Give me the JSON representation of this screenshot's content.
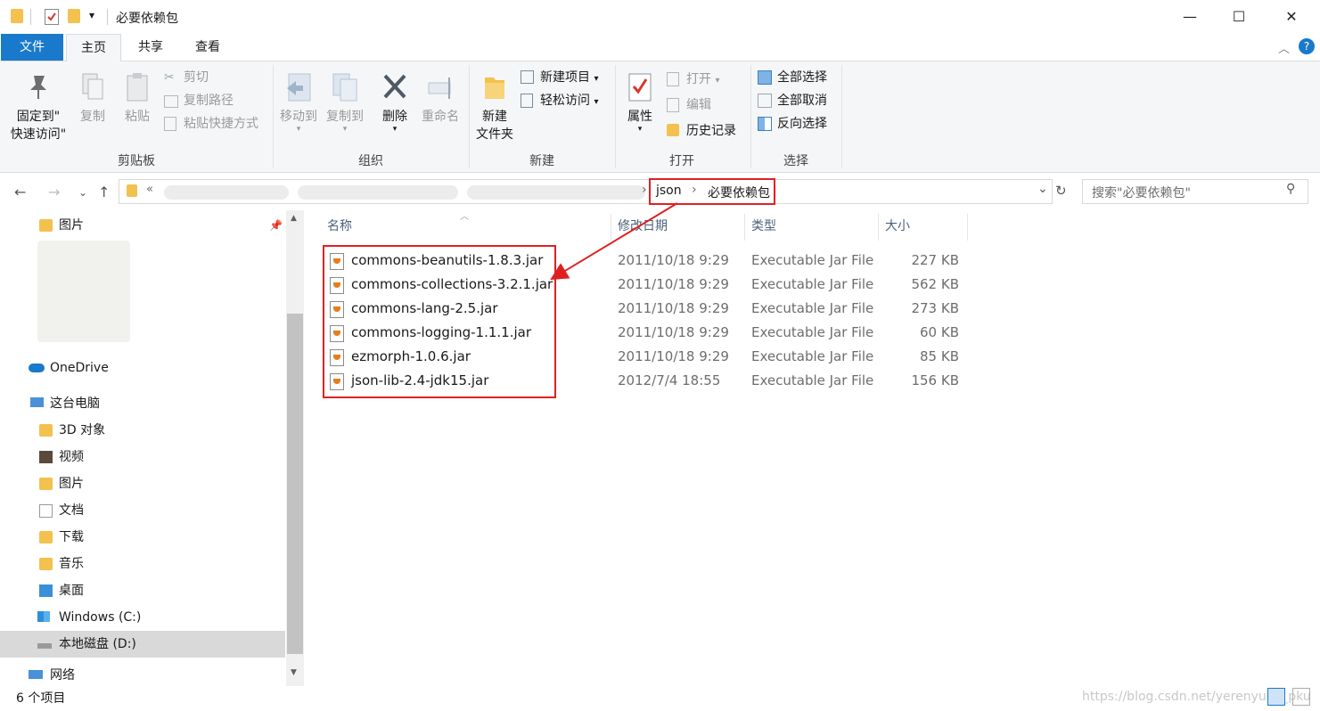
{
  "window": {
    "title": "必要依赖包",
    "controls": {
      "minimize": "—",
      "maximize": "☐",
      "close": "✕"
    },
    "qa_dropdown": "▾"
  },
  "ribbon_tabs": {
    "file": "文件",
    "home": "主页",
    "share": "共享",
    "view": "查看"
  },
  "ribbon": {
    "clipboard": {
      "pin_line1": "固定到\"",
      "pin_line2": "快速访问\"",
      "copy": "复制",
      "paste": "粘贴",
      "cut": "剪切",
      "copy_path": "复制路径",
      "paste_shortcut": "粘贴快捷方式",
      "label": "剪贴板"
    },
    "organize": {
      "move_to": "移动到",
      "copy_to": "复制到",
      "delete": "删除",
      "rename": "重命名",
      "label": "组织"
    },
    "new": {
      "new_folder_line1": "新建",
      "new_folder_line2": "文件夹",
      "new_item": "新建项目",
      "easy_access": "轻松访问",
      "label": "新建"
    },
    "open": {
      "properties": "属性",
      "open": "打开",
      "edit": "编辑",
      "history": "历史记录",
      "label": "打开"
    },
    "select": {
      "select_all": "全部选择",
      "select_none": "全部取消",
      "invert": "反向选择",
      "label": "选择"
    }
  },
  "address": {
    "overflow": "«",
    "crumb1": "json",
    "crumb2": "必要依赖包",
    "search_placeholder": "搜索\"必要依赖包\""
  },
  "nav": {
    "pictures_pinned": "图片",
    "onedrive": "OneDrive",
    "this_pc": "这台电脑",
    "items": [
      "3D 对象",
      "视频",
      "图片",
      "文档",
      "下载",
      "音乐",
      "桌面",
      "Windows (C:)",
      "本地磁盘 (D:)"
    ],
    "network": "网络"
  },
  "columns": {
    "name": "名称",
    "modified": "修改日期",
    "type": "类型",
    "size": "大小"
  },
  "files": [
    {
      "name": "commons-beanutils-1.8.3.jar",
      "modified": "2011/10/18 9:29",
      "type": "Executable Jar File",
      "size": "227 KB"
    },
    {
      "name": "commons-collections-3.2.1.jar",
      "modified": "2011/10/18 9:29",
      "type": "Executable Jar File",
      "size": "562 KB"
    },
    {
      "name": "commons-lang-2.5.jar",
      "modified": "2011/10/18 9:29",
      "type": "Executable Jar File",
      "size": "273 KB"
    },
    {
      "name": "commons-logging-1.1.1.jar",
      "modified": "2011/10/18 9:29",
      "type": "Executable Jar File",
      "size": "60 KB"
    },
    {
      "name": "ezmorph-1.0.6.jar",
      "modified": "2011/10/18 9:29",
      "type": "Executable Jar File",
      "size": "85 KB"
    },
    {
      "name": "json-lib-2.4-jdk15.jar",
      "modified": "2012/7/4 18:55",
      "type": "Executable Jar File",
      "size": "156 KB"
    }
  ],
  "status": {
    "count": "6 个项目",
    "watermark": "https://blog.csdn.net/yerenyuan_pku"
  },
  "colors": {
    "accent": "#1979ca",
    "annotation_red": "#e02020",
    "folder": "#f2c14e"
  }
}
